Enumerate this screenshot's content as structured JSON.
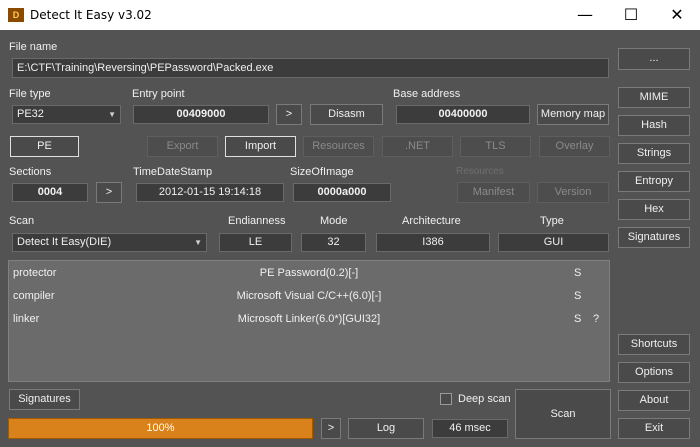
{
  "window": {
    "title": "Detect It Easy v3.02",
    "icon_text": "D",
    "minimize": "—",
    "maximize": "☐",
    "close": "✕"
  },
  "file_name": {
    "label": "File name",
    "value": "E:\\CTF\\Training\\Reversing\\PEPassword\\Packed.exe",
    "browse": "..."
  },
  "file_type": {
    "label": "File type",
    "value": "PE32"
  },
  "entry_point": {
    "label": "Entry point",
    "value": "00409000",
    "go": ">",
    "disasm": "Disasm"
  },
  "base_address": {
    "label": "Base address",
    "value": "00400000",
    "memory_map": "Memory map"
  },
  "pe_button": "PE",
  "tools": {
    "export": "Export",
    "import": "Import",
    "resources": "Resources",
    "net": ".NET",
    "tls": "TLS",
    "overlay": "Overlay"
  },
  "sections": {
    "label": "Sections",
    "value": "0004",
    "go": ">"
  },
  "timestamp": {
    "label": "TimeDateStamp",
    "value": "2012-01-15 19:14:18"
  },
  "size_of_image": {
    "label": "SizeOfImage",
    "value": "0000a000"
  },
  "resources_group": {
    "label": "Resources",
    "manifest": "Manifest",
    "version": "Version"
  },
  "scan": {
    "label": "Scan",
    "value": "Detect It Easy(DIE)"
  },
  "endianness": {
    "label": "Endianness",
    "value": "LE"
  },
  "mode": {
    "label": "Mode",
    "value": "32"
  },
  "architecture": {
    "label": "Architecture",
    "value": "I386"
  },
  "type": {
    "label": "Type",
    "value": "GUI"
  },
  "results": [
    {
      "kind": "protector",
      "name": "PE Password(0.2)[-]",
      "s": "S",
      "q": ""
    },
    {
      "kind": "compiler",
      "name": "Microsoft Visual C/C++(6.0)[-]",
      "s": "S",
      "q": ""
    },
    {
      "kind": "linker",
      "name": "Microsoft Linker(6.0*)[GUI32]",
      "s": "S",
      "q": "?"
    }
  ],
  "bottom": {
    "signatures": "Signatures",
    "deep_scan": "Deep scan",
    "deep_scan_checked": false,
    "progress": "100%",
    "progress_value": 1.0,
    "go": ">",
    "log": "Log",
    "time": "46 msec",
    "scan": "Scan"
  },
  "sidebar": {
    "mime": "MIME",
    "hash": "Hash",
    "strings": "Strings",
    "entropy": "Entropy",
    "hex": "Hex",
    "signatures": "Signatures",
    "shortcuts": "Shortcuts",
    "options": "Options",
    "about": "About",
    "exit": "Exit"
  }
}
